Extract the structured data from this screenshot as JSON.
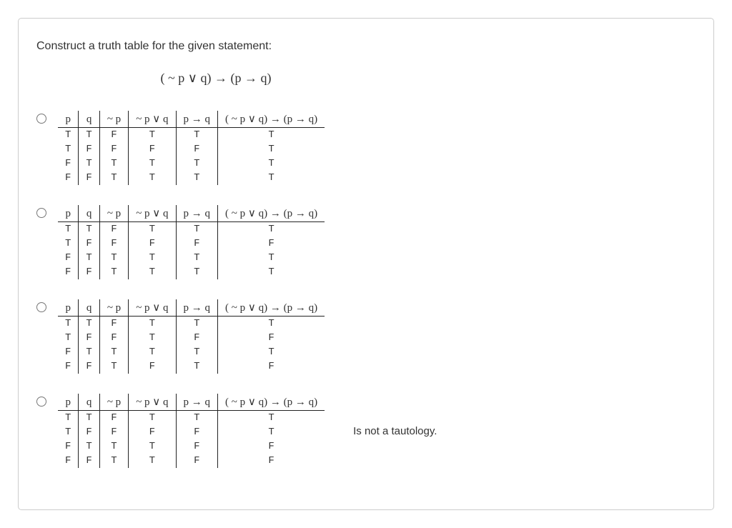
{
  "question": "Construct a truth table for the given statement:",
  "formula": "( ~ p ∨ q) → (p → q)",
  "headers": [
    "p",
    "q",
    "~ p",
    "~ p ∨ q",
    "p → q",
    "( ~ p ∨ q)  →  (p → q)"
  ],
  "options": [
    {
      "rows": [
        [
          "T",
          "T",
          "F",
          "T",
          "T",
          "T"
        ],
        [
          "T",
          "F",
          "F",
          "F",
          "F",
          "T"
        ],
        [
          "F",
          "T",
          "T",
          "T",
          "T",
          "T"
        ],
        [
          "F",
          "F",
          "T",
          "T",
          "T",
          "T"
        ]
      ],
      "note": ""
    },
    {
      "rows": [
        [
          "T",
          "T",
          "F",
          "T",
          "T",
          "T"
        ],
        [
          "T",
          "F",
          "F",
          "F",
          "F",
          "F"
        ],
        [
          "F",
          "T",
          "T",
          "T",
          "T",
          "T"
        ],
        [
          "F",
          "F",
          "T",
          "T",
          "T",
          "T"
        ]
      ],
      "note": ""
    },
    {
      "rows": [
        [
          "T",
          "T",
          "F",
          "T",
          "T",
          "T"
        ],
        [
          "T",
          "F",
          "F",
          "T",
          "F",
          "F"
        ],
        [
          "F",
          "T",
          "T",
          "T",
          "T",
          "T"
        ],
        [
          "F",
          "F",
          "T",
          "F",
          "T",
          "F"
        ]
      ],
      "note": ""
    },
    {
      "rows": [
        [
          "T",
          "T",
          "F",
          "T",
          "T",
          "T"
        ],
        [
          "T",
          "F",
          "F",
          "F",
          "F",
          "T"
        ],
        [
          "F",
          "T",
          "T",
          "T",
          "F",
          "F"
        ],
        [
          "F",
          "F",
          "T",
          "T",
          "F",
          "F"
        ]
      ],
      "note": "Is not a tautology."
    }
  ]
}
